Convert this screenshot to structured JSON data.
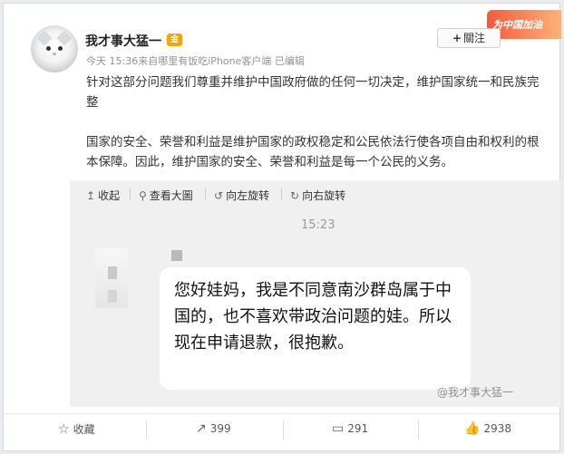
{
  "post": {
    "author_name": "我才事大猛一",
    "badge": "金",
    "meta": "今天 15:36来自哪里有饭吃iPhone客户端   已编辑",
    "follow_label": "關注",
    "follow_icon": "plus-icon",
    "promo_text": "为中国加油",
    "paragraph1": "针对这部分问题我们尊重并维护中国政府做的任何一切决定，维护国家统一和民族完整",
    "paragraph2": "国家的安全、荣誉和利益是维护国家的政权稳定和公民依法行使各项自由和权利的根本保障。因此，维护国家的安全、荣誉和利益是每一个公民的义务。"
  },
  "media_toolbar": {
    "collapse": "收起",
    "view_large": "查看大圖",
    "rotate_left": "向左旋转",
    "rotate_right": "向右旋转"
  },
  "chat": {
    "time": "15:23",
    "message": "您好娃妈，我是不同意南沙群岛属于中国的，也不喜欢带政治问题的娃。所以现在申请退款，很抱歉。",
    "watermark": "@我才事大猛一"
  },
  "footer": {
    "favorite": "收藏",
    "repost_count": "399",
    "comment_count": "291",
    "like_count": "2938"
  },
  "colors": {
    "promo": "#f25b3b",
    "badge": "#f6a400",
    "media_bg": "#f0f0f0"
  }
}
